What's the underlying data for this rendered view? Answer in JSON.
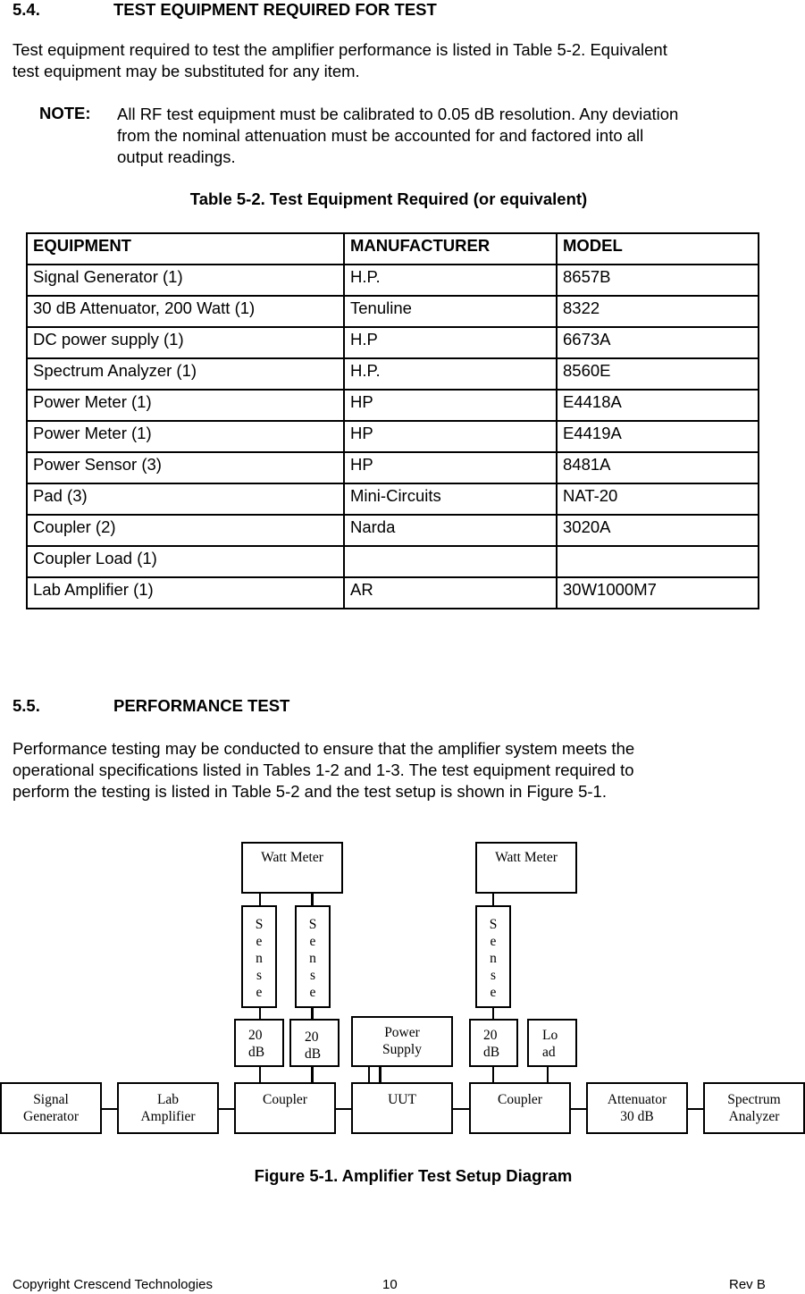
{
  "section_54": {
    "number": "5.4.",
    "title": "TEST EQUIPMENT REQUIRED FOR TEST",
    "paragraph_line1": "Test equipment required to test the amplifier performance is listed in Table 5-2. Equivalent",
    "paragraph_line2": "test equipment may be substituted for any item.",
    "note_label": "NOTE:",
    "note_line1": "All RF test equipment must be calibrated to 0.05 dB resolution. Any deviation",
    "note_line2": "from the nominal attenuation must be accounted for and factored into all",
    "note_line3": "output readings."
  },
  "table": {
    "caption": "Table 5-2. Test Equipment Required (or equivalent)",
    "headers": [
      "EQUIPMENT",
      "MANUFACTURER",
      "MODEL"
    ],
    "rows": [
      [
        "Signal Generator (1)",
        "H.P.",
        "8657B"
      ],
      [
        "30 dB Attenuator, 200 Watt (1)",
        "Tenuline",
        "8322"
      ],
      [
        "DC power supply (1)",
        "H.P",
        "6673A"
      ],
      [
        "Spectrum Analyzer (1)",
        "H.P.",
        "8560E"
      ],
      [
        "Power Meter (1)",
        "HP",
        "E4418A"
      ],
      [
        "Power Meter (1)",
        "HP",
        "E4419A"
      ],
      [
        "Power Sensor (3)",
        "HP",
        "8481A"
      ],
      [
        "Pad (3)",
        "Mini-Circuits",
        "NAT-20"
      ],
      [
        "Coupler (2)",
        "Narda",
        "3020A"
      ],
      [
        "Coupler Load (1)",
        "",
        ""
      ],
      [
        "Lab Amplifier (1)",
        "AR",
        "30W1000M7"
      ]
    ]
  },
  "section_55": {
    "number": "5.5.",
    "title": "PERFORMANCE TEST",
    "line1": "Performance testing may be conducted to ensure that the amplifier system meets the",
    "line2": "operational specifications listed in Tables 1-2 and 1-3.  The test equipment required to",
    "line3": "perform the testing is listed in Table 5-2 and the test setup is shown in Figure 5-1."
  },
  "diagram": {
    "watt_meter_1": "Watt Meter",
    "watt_meter_2": "Watt Meter",
    "sense_letters": [
      "S",
      "e",
      "n",
      "s",
      "e"
    ],
    "pad_1": [
      "20",
      "dB"
    ],
    "pad_2": [
      "20",
      "dB"
    ],
    "pad_3": [
      "20",
      "dB"
    ],
    "power_supply": [
      "Power",
      "Supply"
    ],
    "load": [
      "Lo",
      "ad"
    ],
    "signal_generator": [
      "Signal",
      "Generator"
    ],
    "lab_amplifier": [
      "Lab",
      "Amplifier"
    ],
    "coupler_1": "Coupler",
    "uut": "UUT",
    "coupler_2": "Coupler",
    "attenuator": [
      "Attenuator",
      "30 dB"
    ],
    "spectrum_analyzer": [
      "Spectrum",
      "Analyzer"
    ]
  },
  "figure_caption": "Figure 5-1. Amplifier Test Setup Diagram",
  "footer": {
    "copyright": "Copyright Crescend Technologies",
    "page_number": "10",
    "revision": "Rev B"
  }
}
